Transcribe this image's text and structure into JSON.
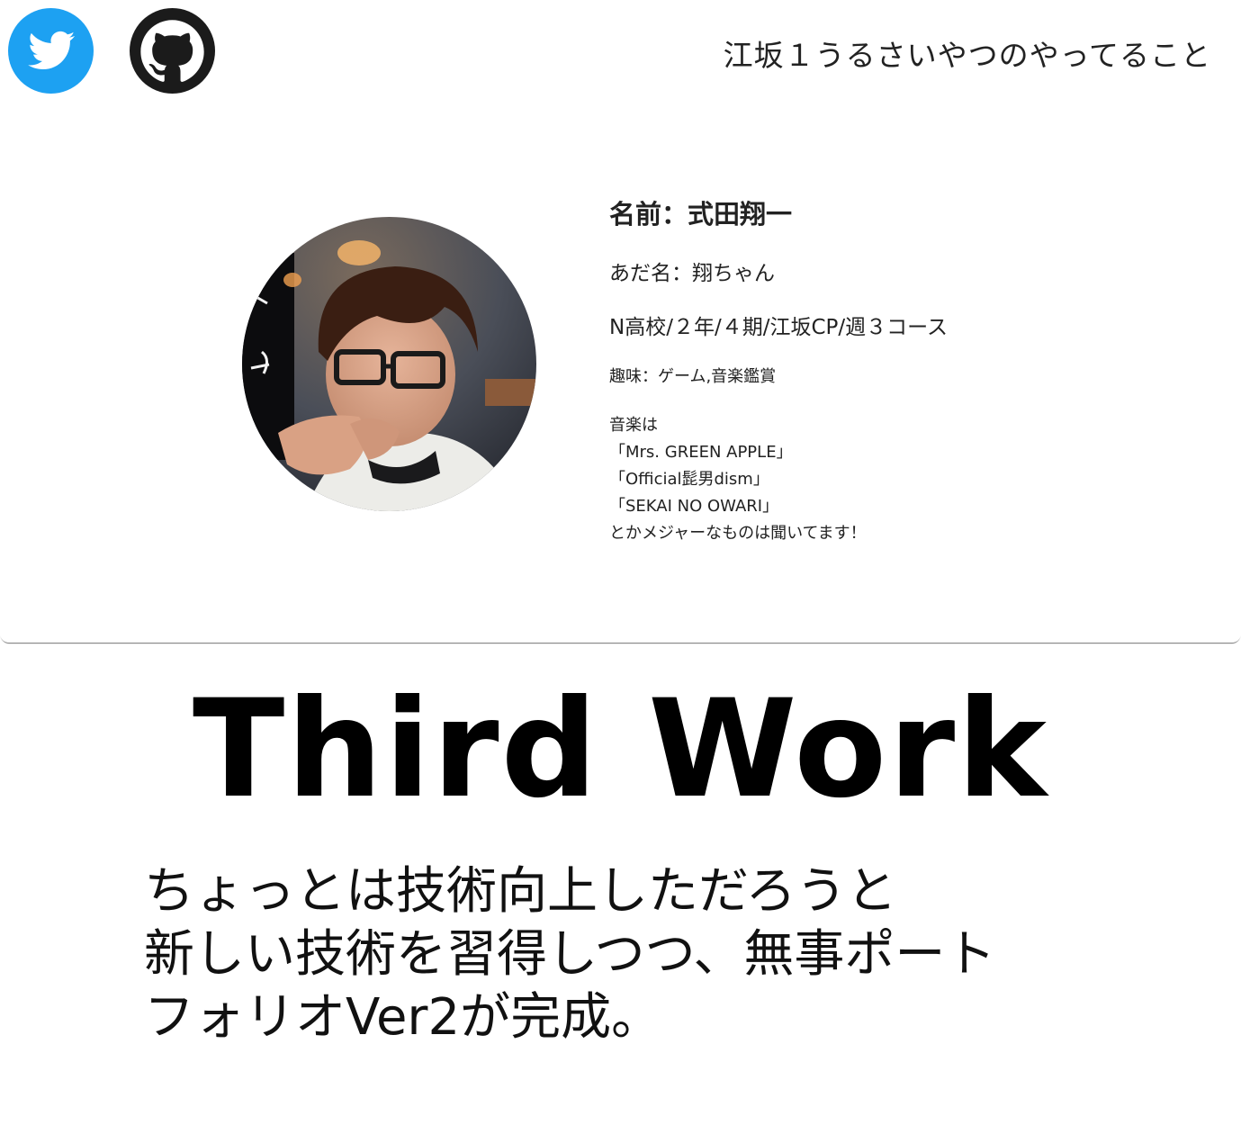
{
  "header": {
    "site_title": "江坂１うるさいやつのやってること",
    "social": [
      {
        "icon": "twitter-icon",
        "color": "#1da1f2"
      },
      {
        "icon": "github-icon",
        "color": "#1b1b1b"
      }
    ]
  },
  "profile": {
    "name": "名前：式田翔一",
    "nickname": "あだ名：翔ちゃん",
    "school": "N高校/２年/４期/江坂CP/週３コース",
    "hobby": "趣味：ゲーム,音楽鑑賞",
    "music_lines": [
      "音楽は",
      "「Mrs. GREEN APPLE」",
      "「Official髭男dism」",
      "「SEKAI NO OWARI」",
      "とかメジャーなものは聞いてます！"
    ]
  },
  "work": {
    "title": "Third Work",
    "description_lines": [
      "ちょっとは技術向上しただろうと",
      "新しい技術を習得しつつ、無事ポート",
      "フォリオVer2が完成。"
    ]
  }
}
